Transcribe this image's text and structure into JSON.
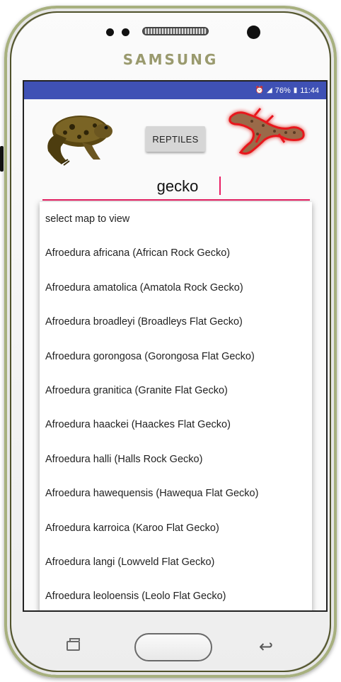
{
  "device": {
    "brand": "SAMSUNG"
  },
  "status_bar": {
    "battery": "76%",
    "time": "11:44",
    "icons": [
      "alarm-icon",
      "signal-icon",
      "battery-icon"
    ]
  },
  "header": {
    "left_image": "frog-image",
    "right_image": "gecko-image",
    "button_label": "REPTILES"
  },
  "search": {
    "value": "gecko"
  },
  "dropdown": {
    "items": [
      "select map to view",
      "Afroedura africana (African Rock Gecko)",
      "Afroedura amatolica (Amatola Rock Gecko)",
      "Afroedura broadleyi (Broadleys Flat Gecko)",
      "Afroedura gorongosa (Gorongosa Flat Gecko)",
      "Afroedura granitica (Granite Flat Gecko)",
      "Afroedura haackei (Haackes Flat Gecko)",
      "Afroedura halli (Halls Rock Gecko)",
      "Afroedura hawequensis (Hawequa Flat Gecko)",
      "Afroedura karroica (Karoo Flat Gecko)",
      "Afroedura langi (Lowveld Flat Gecko)",
      "Afroedura leoloensis (Leolo Flat Gecko)"
    ]
  },
  "nav": {
    "icons": [
      "recent-apps-icon",
      "home-button",
      "back-icon"
    ]
  },
  "colors": {
    "status_bar": "#3f51b5",
    "accent": "#e91e63",
    "button": "#d6d6d6"
  }
}
